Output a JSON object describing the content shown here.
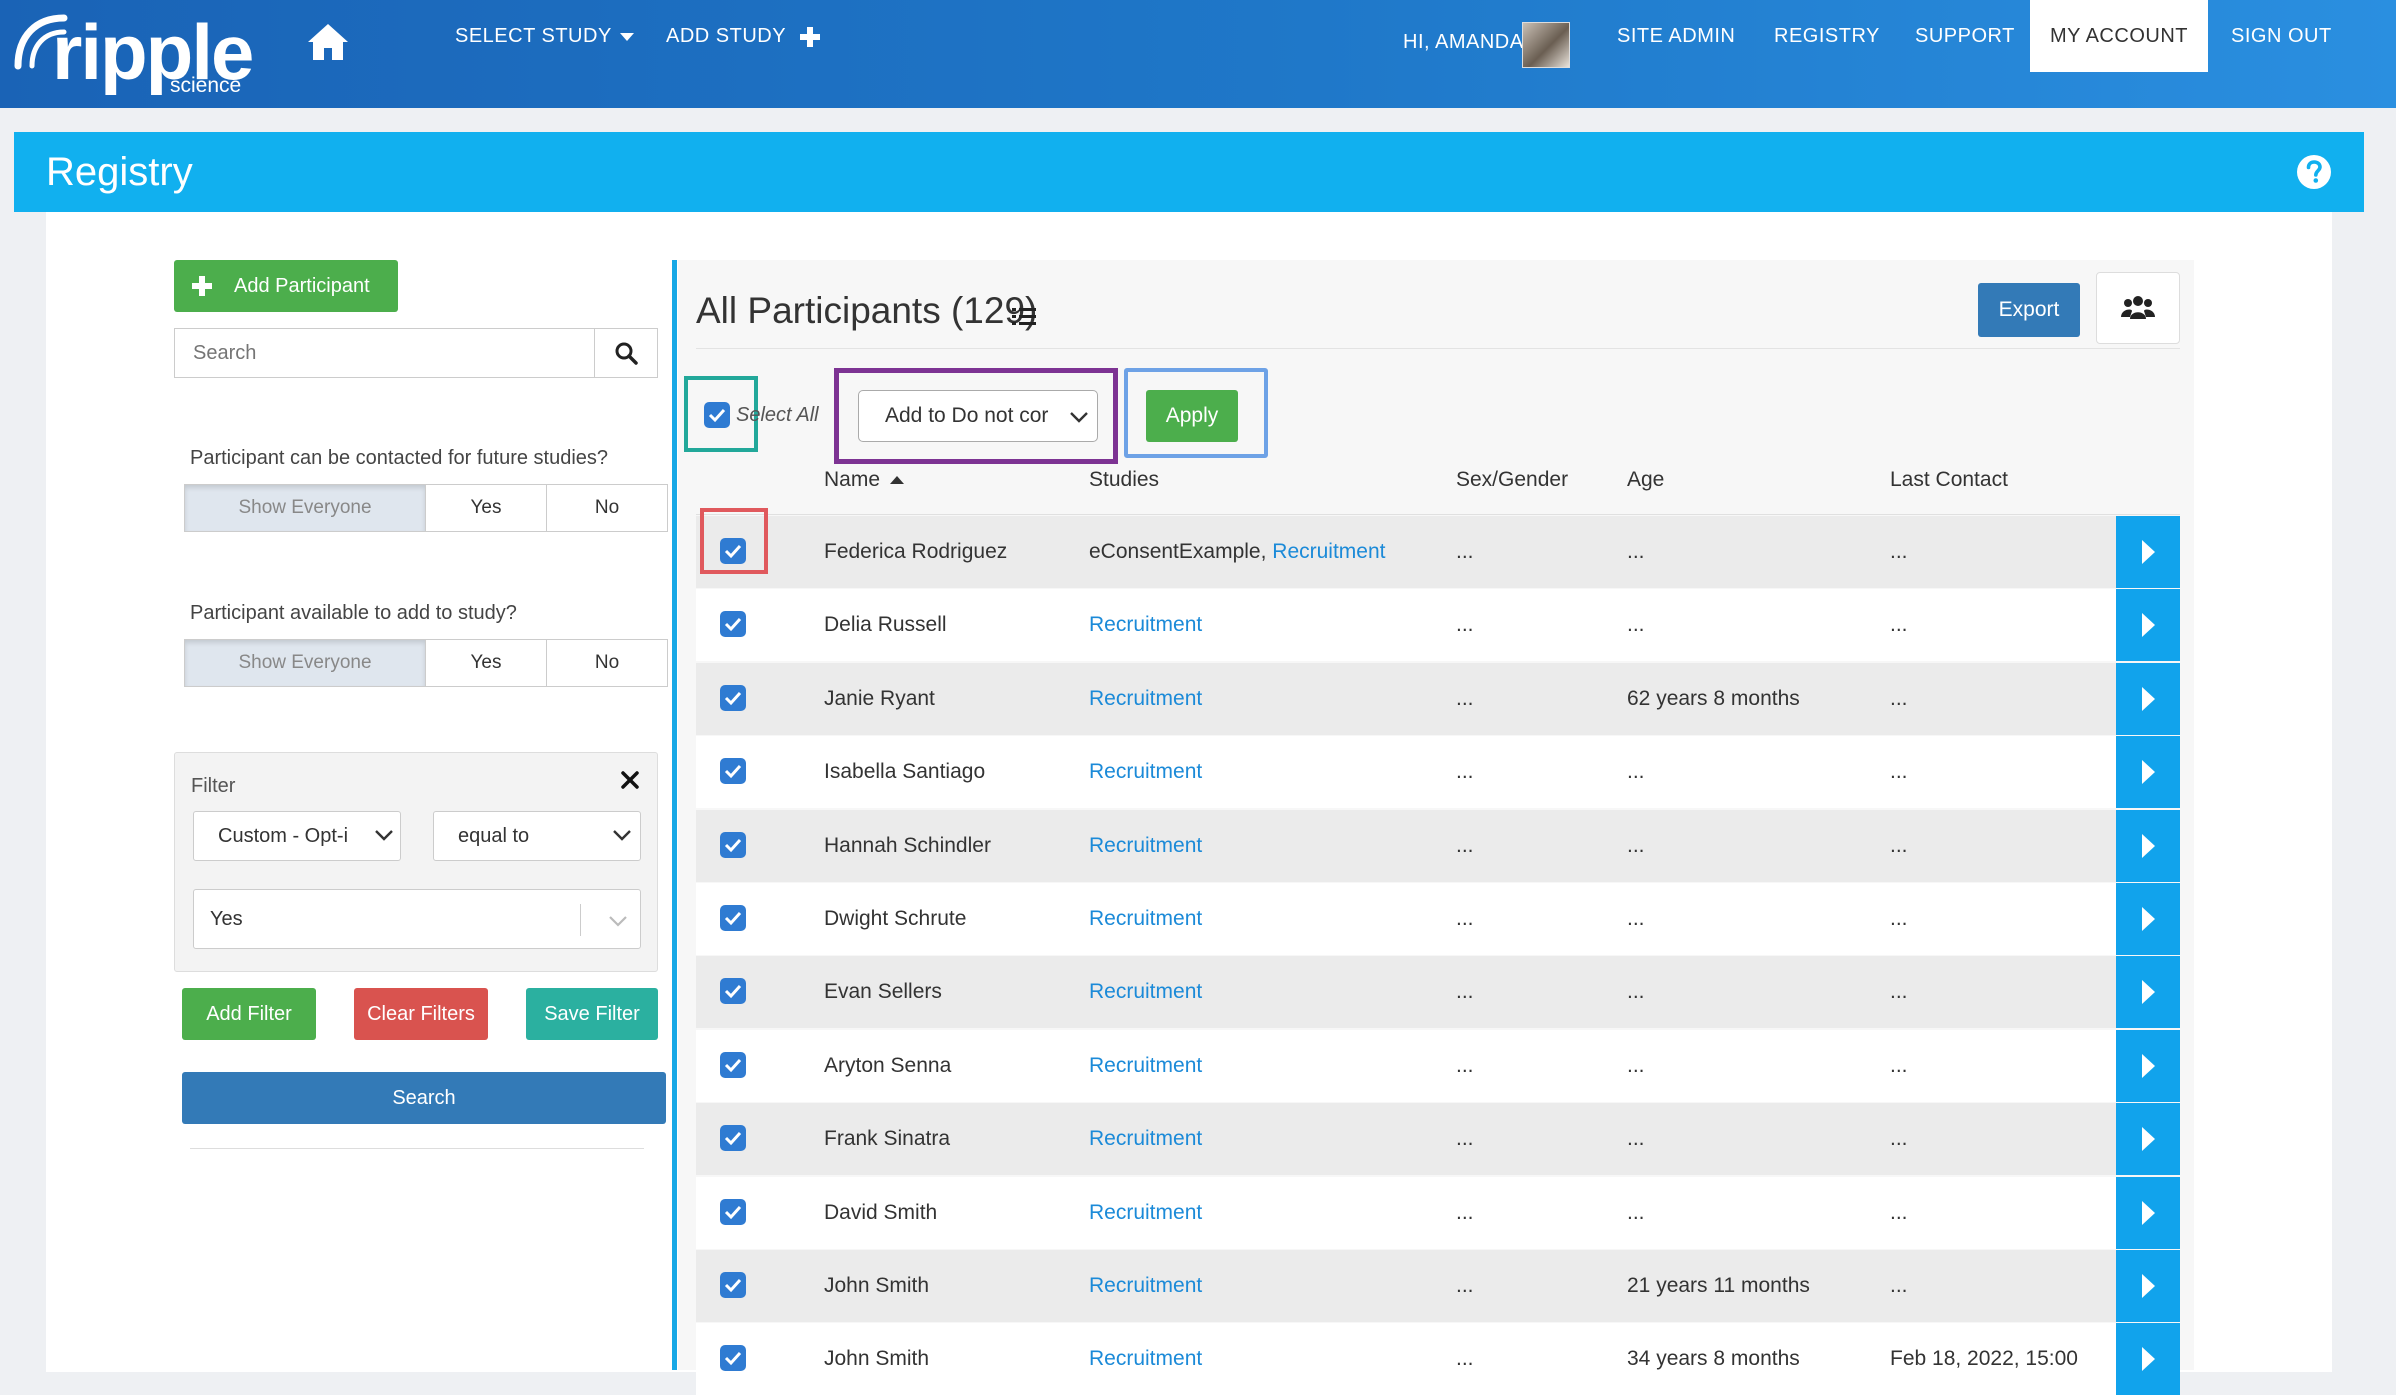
{
  "nav": {
    "logo_word": "ripple",
    "logo_sub": "science",
    "select_study": "SELECT STUDY",
    "add_study": "ADD STUDY",
    "greeting": "HI, AMANDA",
    "site_admin": "SITE ADMIN",
    "registry": "REGISTRY",
    "support": "SUPPORT",
    "my_account": "MY ACCOUNT",
    "sign_out": "SIGN OUT",
    "colors": {
      "gradient_start": "#1a63b6",
      "gradient_end": "#2a8fe0"
    }
  },
  "page": {
    "title": "Registry",
    "accent": "#11b0ef"
  },
  "sidebar": {
    "add_participant": "Add Participant",
    "search_placeholder": "Search",
    "q1": {
      "label": "Participant can be contacted for future studies?",
      "options": [
        "Show Everyone",
        "Yes",
        "No"
      ],
      "selected": "Show Everyone"
    },
    "q2": {
      "label": "Participant available to add to study?",
      "options": [
        "Show Everyone",
        "Yes",
        "No"
      ],
      "selected": "Show Everyone"
    },
    "filter": {
      "label": "Filter",
      "field": "Custom - Opt-i",
      "operator": "equal to",
      "value": "Yes"
    },
    "add_filter": "Add Filter",
    "clear_filters": "Clear Filters",
    "save_filter": "Save Filter",
    "search_button": "Search"
  },
  "participants": {
    "title": "All Participants (129)",
    "export": "Export",
    "select_all": "Select All",
    "bulk_action": "Add to Do not cor",
    "apply": "Apply",
    "columns": [
      "Name",
      "Studies",
      "Sex/Gender",
      "Age",
      "Last Contact"
    ],
    "rows": [
      {
        "name": "Federica Rodriguez",
        "study_prefix": "eConsentExample, ",
        "study": "Recruitment",
        "sex": "...",
        "age": "...",
        "last": "..."
      },
      {
        "name": "Delia Russell",
        "study_prefix": "",
        "study": "Recruitment",
        "sex": "...",
        "age": "...",
        "last": "..."
      },
      {
        "name": "Janie Ryant",
        "study_prefix": "",
        "study": "Recruitment",
        "sex": "...",
        "age": "62 years 8 months",
        "last": "..."
      },
      {
        "name": "Isabella Santiago",
        "study_prefix": "",
        "study": "Recruitment",
        "sex": "...",
        "age": "...",
        "last": "..."
      },
      {
        "name": "Hannah Schindler",
        "study_prefix": "",
        "study": "Recruitment",
        "sex": "...",
        "age": "...",
        "last": "..."
      },
      {
        "name": "Dwight Schrute",
        "study_prefix": "",
        "study": "Recruitment",
        "sex": "...",
        "age": "...",
        "last": "..."
      },
      {
        "name": "Evan Sellers",
        "study_prefix": "",
        "study": "Recruitment",
        "sex": "...",
        "age": "...",
        "last": "..."
      },
      {
        "name": "Aryton Senna",
        "study_prefix": "",
        "study": "Recruitment",
        "sex": "...",
        "age": "...",
        "last": "..."
      },
      {
        "name": "Frank Sinatra",
        "study_prefix": "",
        "study": "Recruitment",
        "sex": "...",
        "age": "...",
        "last": "..."
      },
      {
        "name": "David Smith",
        "study_prefix": "",
        "study": "Recruitment",
        "sex": "...",
        "age": "...",
        "last": "..."
      },
      {
        "name": "John Smith",
        "study_prefix": "",
        "study": "Recruitment",
        "sex": "...",
        "age": "21 years 11 months",
        "last": "..."
      },
      {
        "name": "John Smith",
        "study_prefix": "",
        "study": "Recruitment",
        "sex": "...",
        "age": "34 years 8 months",
        "last": "Feb 18, 2022, 15:00"
      }
    ]
  }
}
